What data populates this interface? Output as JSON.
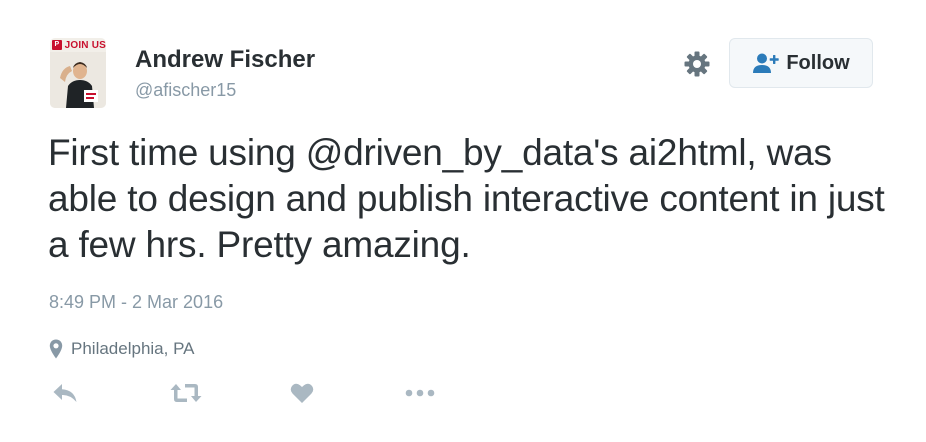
{
  "user": {
    "name": "Andrew Fischer",
    "handle": "@afischer15",
    "avatar_banner_text": "JOIN US"
  },
  "follow_button": {
    "label": "Follow"
  },
  "tweet": {
    "text": "First time using @driven_by_data's ai2html, was able to design and publish interactive content in just a few hrs. Pretty amazing.",
    "timestamp": "8:49 PM - 2 Mar 2016",
    "location": "Philadelphia, PA"
  },
  "icons": {
    "settings": "gear-icon",
    "follow": "add-user-icon",
    "location": "map-pin-icon",
    "reply": "reply-icon",
    "retweet": "retweet-icon",
    "like": "heart-icon",
    "more": "more-dots-icon"
  },
  "colors": {
    "text": "#292f33",
    "secondary": "#8899a6",
    "accent": "#2b7bb9",
    "action_icons": "#aab8c2",
    "button_bg": "#f5f8fa",
    "button_border": "#e1e8ed",
    "avatar_brand": "#c8102e"
  }
}
